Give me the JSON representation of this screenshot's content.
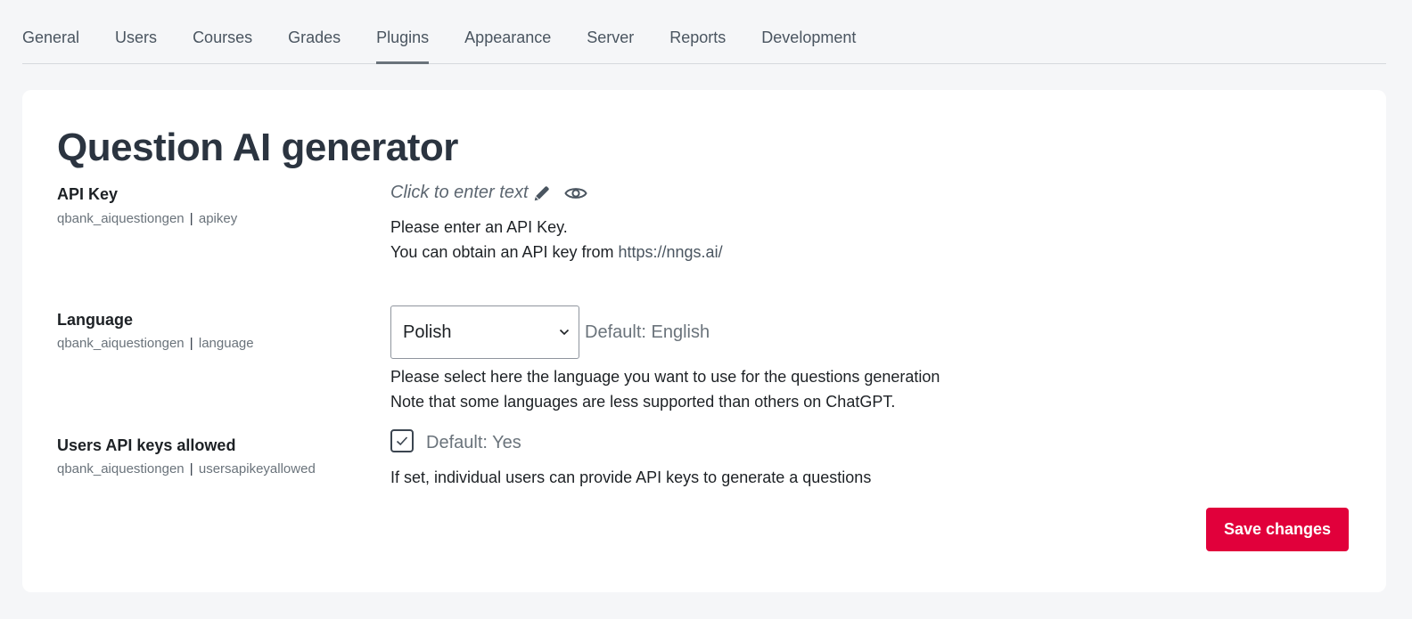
{
  "tabs": [
    {
      "label": "General",
      "active": false
    },
    {
      "label": "Users",
      "active": false
    },
    {
      "label": "Courses",
      "active": false
    },
    {
      "label": "Grades",
      "active": false
    },
    {
      "label": "Plugins",
      "active": true
    },
    {
      "label": "Appearance",
      "active": false
    },
    {
      "label": "Server",
      "active": false
    },
    {
      "label": "Reports",
      "active": false
    },
    {
      "label": "Development",
      "active": false
    }
  ],
  "page": {
    "title": "Question AI generator"
  },
  "settings": {
    "apikey": {
      "label": "API Key",
      "plugin": "qbank_aiquestiongen",
      "name": "apikey",
      "value_placeholder": "Click to enter text",
      "desc_line1": "Please enter an API Key.",
      "desc_line2_prefix": "You can obtain an API key from ",
      "desc_link": "https://nngs.ai/",
      "edit_icon": "pencil-icon",
      "reveal_icon": "eye-icon"
    },
    "language": {
      "label": "Language",
      "plugin": "qbank_aiquestiongen",
      "name": "language",
      "selected": "Polish",
      "default": "Default: English",
      "desc_line1": "Please select here the language you want to use for the questions generation",
      "desc_line2": "Note that some languages are less supported than others on ChatGPT."
    },
    "usersapikey": {
      "label": "Users API keys allowed",
      "plugin": "qbank_aiquestiongen",
      "name": "usersapikeyallowed",
      "checked": true,
      "default": "Default: Yes",
      "desc": "If set, individual users can provide API keys to generate a questions"
    }
  },
  "actions": {
    "save_label": "Save changes"
  },
  "colors": {
    "accent": "#e1003b",
    "background": "#f5f6f8",
    "card": "#ffffff"
  }
}
